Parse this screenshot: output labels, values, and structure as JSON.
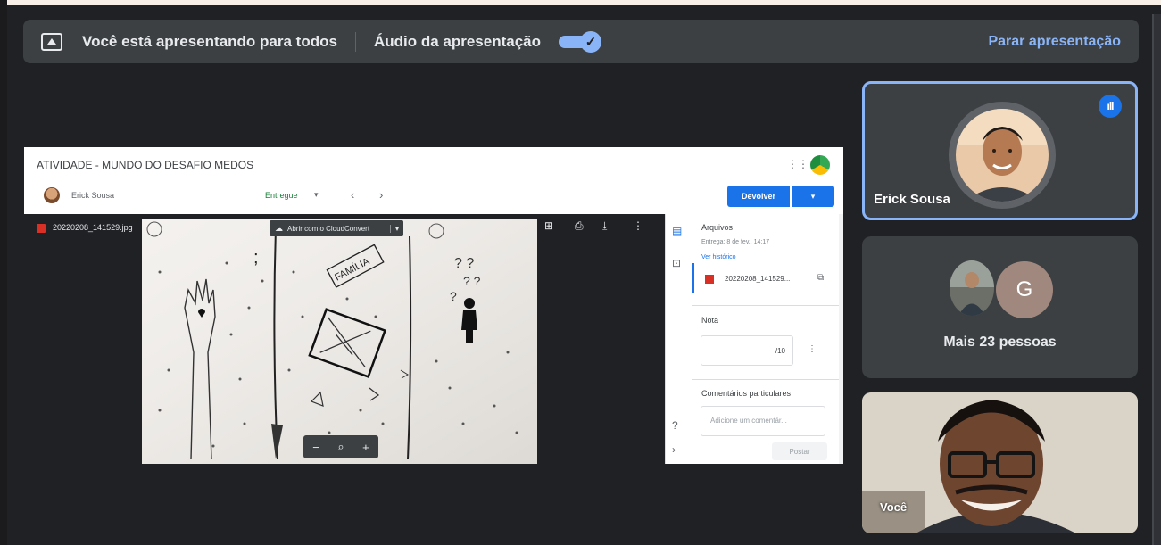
{
  "banner": {
    "presenting_text": "Você está apresentando para todos",
    "audio_label": "Áudio da apresentação",
    "audio_enabled": true,
    "stop_label": "Parar apresentação"
  },
  "shared": {
    "assignment_title": "ATIVIDADE - MUNDO DO DESAFIO MEDOS",
    "student_name": "Erick Sousa",
    "status": "Entregue",
    "return_button": "Devolver",
    "file_name": "20220208_141529.jpg",
    "open_with": "Abrir com o CloudConvert",
    "panel": {
      "files_title": "Arquivos",
      "delivered": "Entrega: 8 de fev., 14:17",
      "history_link": "Ver histórico",
      "attachment_name": "20220208_141529...",
      "grade_title": "Nota",
      "grade_value": "/10",
      "comments_title": "Comentários particulares",
      "comment_placeholder": "Adicione um comentár...",
      "post_button": "Postar"
    }
  },
  "participants": {
    "presenter_name": "Erick Sousa",
    "others_label": "Mais 23 pessoas",
    "others_initial": "G",
    "self_label": "Você"
  },
  "colors": {
    "accent": "#8ab4f8",
    "meet_bg": "#202124",
    "tile_bg": "#3c4043",
    "classroom_blue": "#1a73e8",
    "entregue_green": "#188038"
  },
  "icons": [
    "present-to-all-icon",
    "check-icon",
    "apps-grid-icon",
    "drive-icon",
    "cloud-icon",
    "add-comment-icon",
    "print-icon",
    "download-icon",
    "more-vert-icon",
    "zoom-out-icon",
    "zoom-icon",
    "zoom-in-icon",
    "speaking-icon",
    "file-icon",
    "open-in-new-icon",
    "help-icon",
    "chevron-right-icon"
  ]
}
